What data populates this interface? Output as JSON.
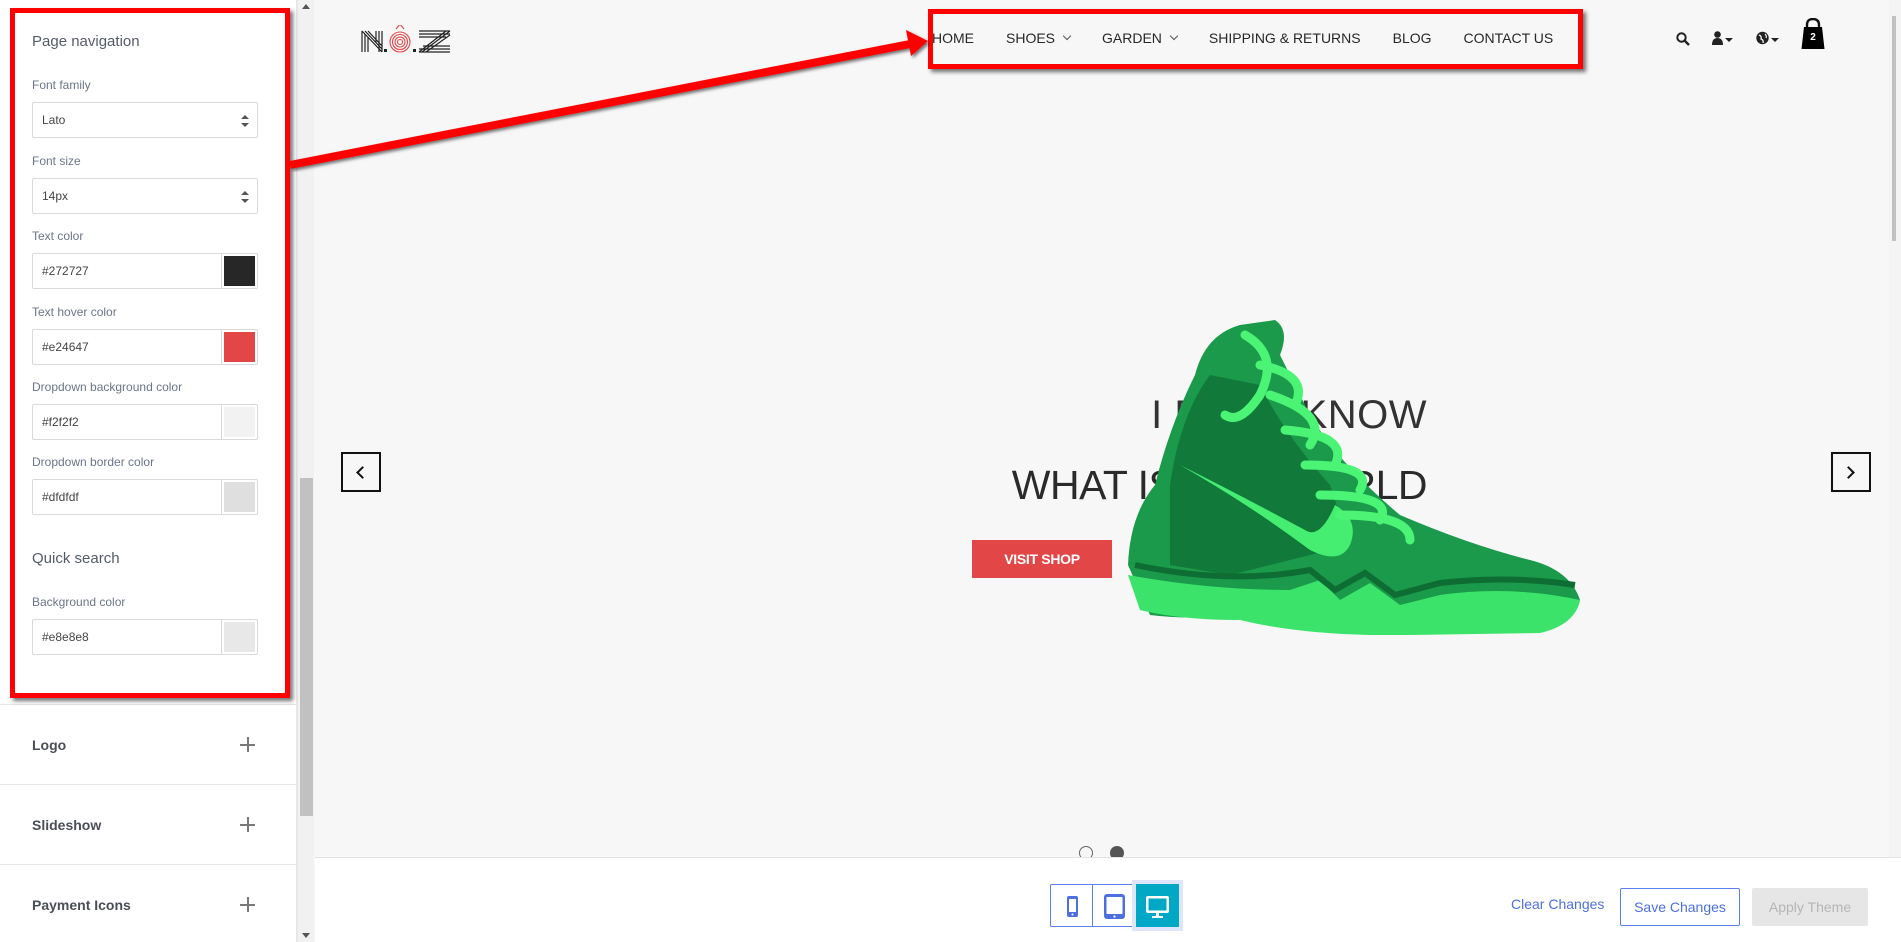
{
  "sidebar": {
    "page_navigation": {
      "title": "Page navigation",
      "font_family": {
        "label": "Font family",
        "value": "Lato"
      },
      "font_size": {
        "label": "Font size",
        "value": "14px"
      },
      "text_color": {
        "label": "Text color",
        "value": "#272727",
        "swatch": "#272727"
      },
      "text_hover_color": {
        "label": "Text hover color",
        "value": "#e24647",
        "swatch": "#e24647"
      },
      "dropdown_bg_color": {
        "label": "Dropdown background color",
        "value": "#f2f2f2",
        "swatch": "#f2f2f2"
      },
      "dropdown_border_color": {
        "label": "Dropdown border color",
        "value": "#dfdfdf",
        "swatch": "#dfdfdf"
      }
    },
    "quick_search": {
      "title": "Quick search",
      "background_color": {
        "label": "Background color",
        "value": "#e8e8e8",
        "swatch": "#e8e8e8"
      }
    },
    "accordions": [
      {
        "label": "Logo"
      },
      {
        "label": "Slideshow"
      },
      {
        "label": "Payment Icons"
      }
    ]
  },
  "preview": {
    "logo_text": "N.Ô.Z",
    "nav": [
      {
        "label": "HOME",
        "dropdown": false
      },
      {
        "label": "SHOES",
        "dropdown": true
      },
      {
        "label": "GARDEN",
        "dropdown": true
      },
      {
        "label": "SHIPPING & RETURNS",
        "dropdown": false
      },
      {
        "label": "BLOG",
        "dropdown": false
      },
      {
        "label": "CONTACT US",
        "dropdown": false
      }
    ],
    "header_icons": {
      "search": "search-icon",
      "account": "user-icon",
      "currency": "globe-icon",
      "cart": "shopping-bag-icon",
      "cart_count": "2"
    },
    "slide": {
      "line1": "I DONT KNOW",
      "line2": "WHAT IS THE WORLD",
      "button": "VISIT SHOP",
      "active_dot": 2,
      "total_dots": 2
    }
  },
  "bottombar": {
    "devices": [
      "mobile",
      "tablet",
      "desktop"
    ],
    "active_device": "desktop",
    "clear": "Clear Changes",
    "save": "Save Changes",
    "apply": "Apply Theme"
  },
  "colors": {
    "accent_red": "#e24647",
    "annotation_red": "#ff0000",
    "primary_blue": "#4e6fe0",
    "active_device": "#00a8c6"
  }
}
